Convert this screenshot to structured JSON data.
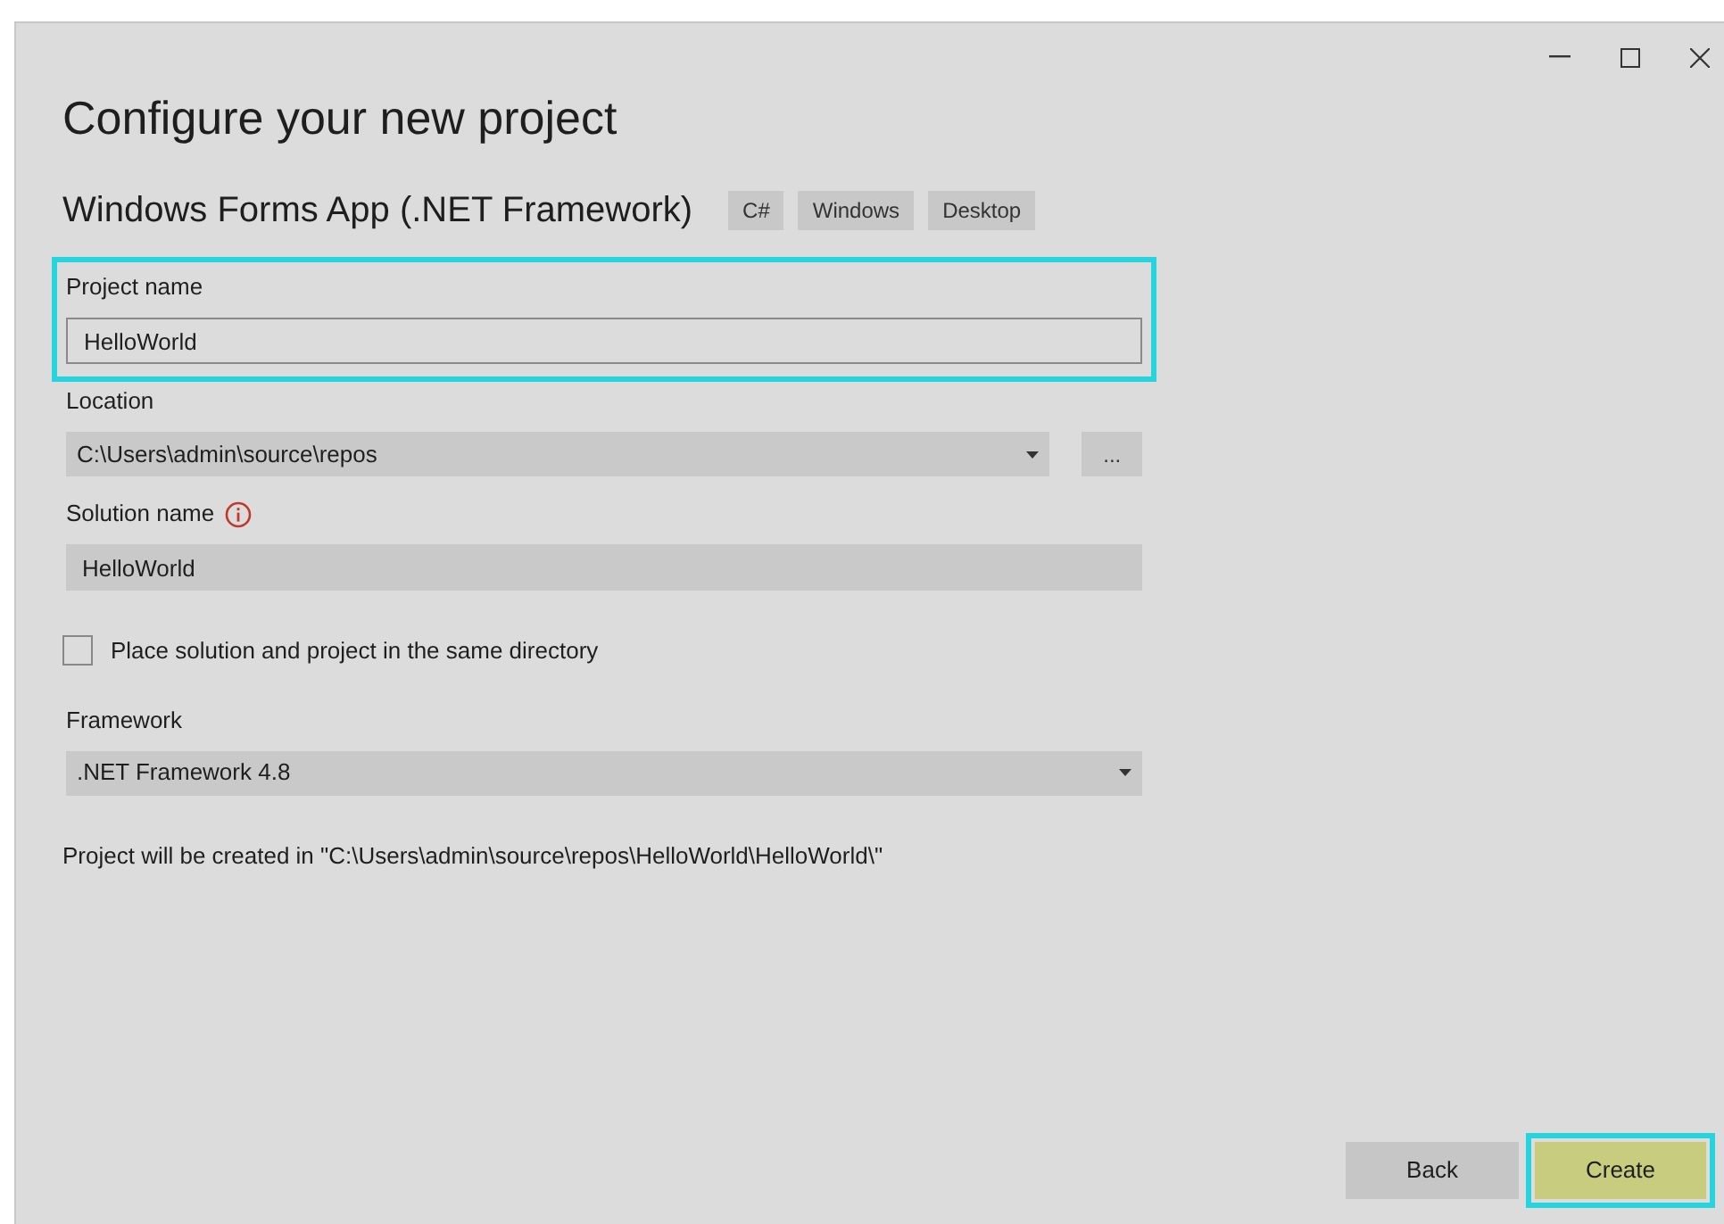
{
  "heading": "Configure your new project",
  "template": {
    "name": "Windows Forms App (.NET Framework)",
    "tags": [
      "C#",
      "Windows",
      "Desktop"
    ]
  },
  "fields": [
    {
      "kind": "text",
      "label": "Project name",
      "value": "HelloWorld",
      "highlighted": true,
      "filled": false
    },
    {
      "kind": "combo",
      "label": "Location",
      "value": "C:\\Users\\admin\\source\\repos",
      "browse": "...",
      "highlighted": false
    },
    {
      "kind": "text",
      "label": "Solution name",
      "value": "HelloWorld",
      "info": true,
      "highlighted": false,
      "filled": true
    },
    {
      "kind": "checkbox",
      "label": "Place solution and project in the same directory",
      "checked": false
    },
    {
      "kind": "combo",
      "label": "Framework",
      "value": ".NET Framework 4.8",
      "highlighted": false
    },
    {
      "kind": "note",
      "label": "Project will be created in \"C:\\Users\\admin\\source\\repos\\HelloWorld\\HelloWorld\\\""
    }
  ],
  "buttons": [
    {
      "label": "Back",
      "primary": false,
      "highlighted": false
    },
    {
      "label": "Create",
      "primary": true,
      "highlighted": true
    }
  ]
}
